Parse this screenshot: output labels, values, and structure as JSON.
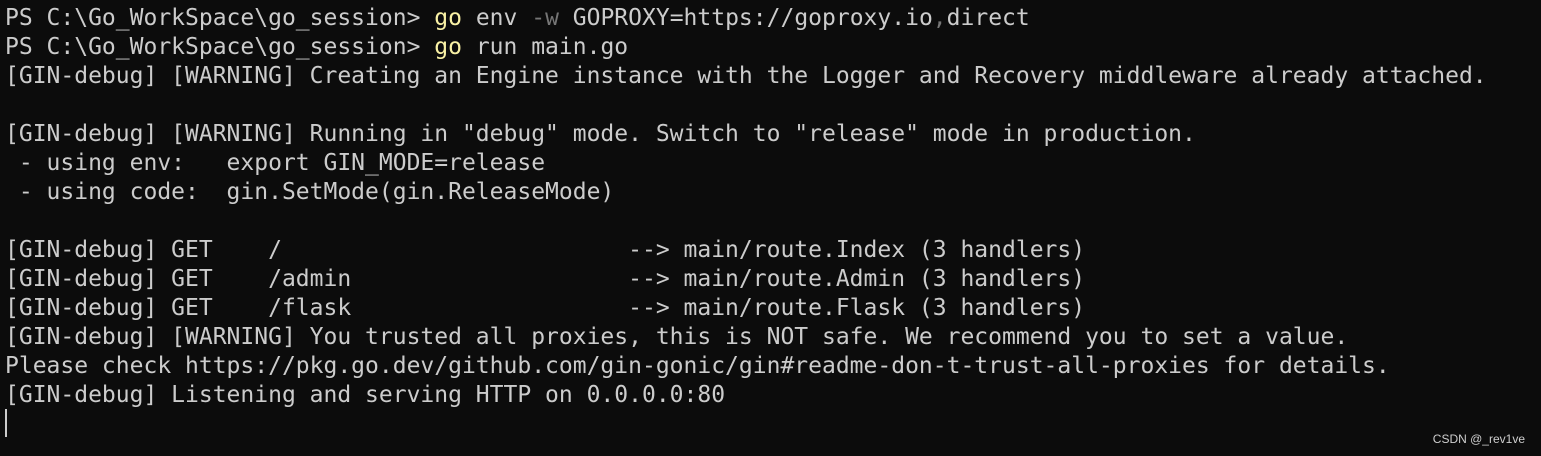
{
  "terminal": {
    "prompt1": {
      "prompt": "PS C:\\Go_WorkSpace\\go_session> ",
      "cmd": "go",
      "arg1": " env ",
      "flag": "-w",
      "arg2": " GOPROXY=https://goproxy.io",
      "sep": ",",
      "arg3": "direct"
    },
    "prompt2": {
      "prompt": "PS C:\\Go_WorkSpace\\go_session> ",
      "cmd": "go",
      "args": " run main.go"
    },
    "lines": [
      "[GIN-debug] [WARNING] Creating an Engine instance with the Logger and Recovery middleware already attached.",
      "",
      "[GIN-debug] [WARNING] Running in \"debug\" mode. Switch to \"release\" mode in production.",
      " - using env:   export GIN_MODE=release",
      " - using code:  gin.SetMode(gin.ReleaseMode)",
      "",
      "[GIN-debug] GET    /                         --> main/route.Index (3 handlers)",
      "[GIN-debug] GET    /admin                    --> main/route.Admin (3 handlers)",
      "[GIN-debug] GET    /flask                    --> main/route.Flask (3 handlers)",
      "[GIN-debug] [WARNING] You trusted all proxies, this is NOT safe. We recommend you to set a value.",
      "Please check https://pkg.go.dev/github.com/gin-gonic/gin#readme-don-t-trust-all-proxies for details.",
      "[GIN-debug] Listening and serving HTTP on 0.0.0.0:80"
    ]
  },
  "watermark": "CSDN @_rev1ve",
  "colors": {
    "background": "#0c0c0c",
    "text": "#cccccc",
    "command": "#f9f1a5",
    "flag": "#767676"
  }
}
